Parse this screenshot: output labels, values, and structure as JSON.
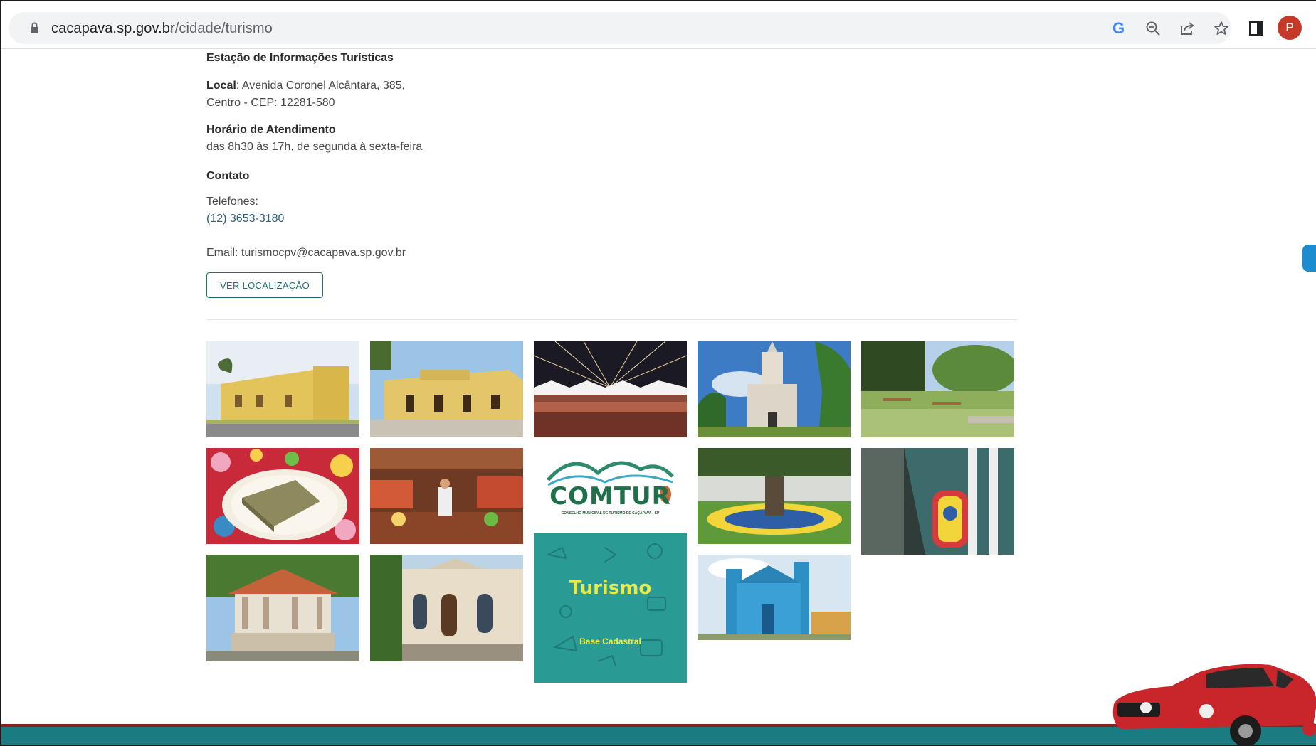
{
  "browser": {
    "url_host": "cacapava.sp.gov.br",
    "url_path": "/cidade/turismo",
    "avatar_letter": "P",
    "icons": [
      "lock-icon",
      "google-icon",
      "zoom-icon",
      "share-icon",
      "star-icon",
      "sidepanel-icon"
    ]
  },
  "info": {
    "title": "Estação de Informações Turísticas",
    "local_label": "Local",
    "local_line1": ": Avenida Coronel Alcântara, 385,",
    "local_line2": "Centro - CEP: 12281-580",
    "hours_title": "Horário de Atendimento",
    "hours_text": "das 8h30 às 17h, de segunda à sexta-feira",
    "contact_title": "Contato",
    "phones_label": "Telefones:",
    "phone": "(12) 3653-3180",
    "email": "Email: turismocpv@cacapava.sp.gov.br",
    "location_button": "VER LOCALIZAÇÃO"
  },
  "gallery": {
    "comtur_logo": "COMTUR",
    "comtur_sub": "CONSELHO MUNICIPAL DE TURISMO DE CAÇAPAVA - SP",
    "turismo_title": "Turismo",
    "turismo_sub": "Base Cadastral"
  },
  "colors": {
    "footer": "#1a7b80",
    "footer_border": "#8c1f24",
    "button": "#1f6f7a"
  }
}
